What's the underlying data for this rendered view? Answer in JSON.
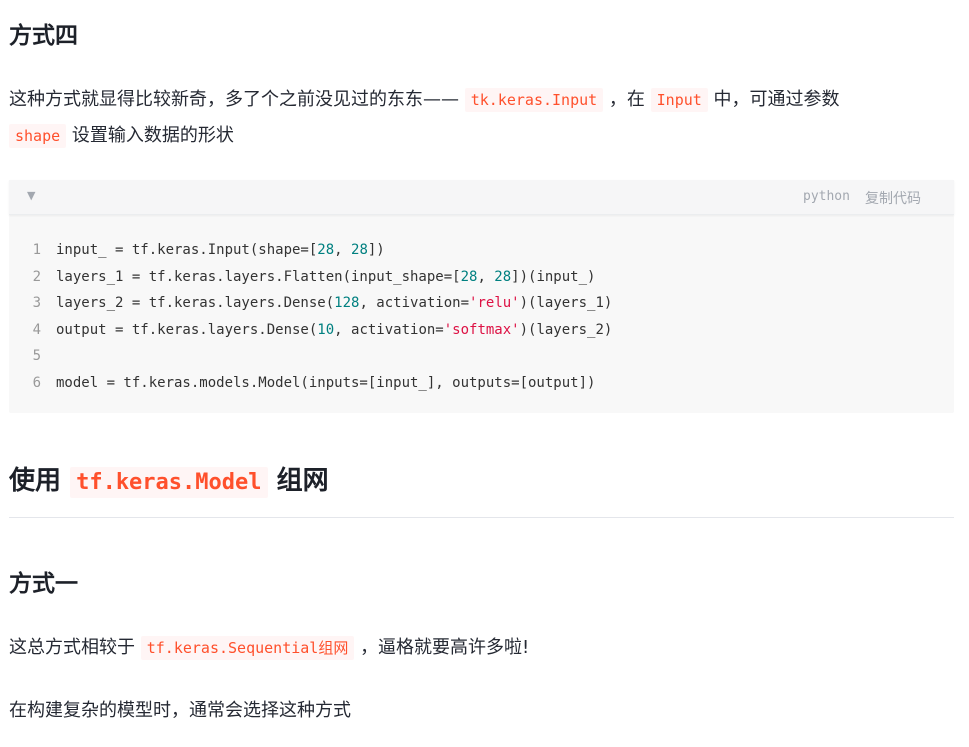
{
  "section4": {
    "heading": "方式四",
    "para1_part1": "这种方式就显得比较新奇，多了个之前没见过的东东——",
    "para1_code1": "tk.keras.Input",
    "para1_part2": "，在",
    "para1_code2": "Input",
    "para1_part3": "中，可通过参数",
    "para1_code3": "shape",
    "para1_part4": "设置输入数据的形状"
  },
  "codeblock": {
    "toggle_icon": "▼",
    "language": "python",
    "copy_label": "复制代码",
    "lines": [
      {
        "no": "1",
        "parts": [
          "input_ = tf.keras.Input(shape=[",
          "28",
          ", ",
          "28",
          "])"
        ]
      },
      {
        "no": "2",
        "parts": [
          "layers_1 = tf.keras.layers.Flatten(input_shape=[",
          "28",
          ", ",
          "28",
          "])(input_)"
        ]
      },
      {
        "no": "3",
        "parts": [
          "layers_2 = tf.keras.layers.Dense(",
          "128",
          ", activation=",
          "'relu'",
          ")(layers_1)"
        ]
      },
      {
        "no": "4",
        "parts": [
          "output = tf.keras.layers.Dense(",
          "10",
          ", activation=",
          "'softmax'",
          ")(layers_2)"
        ]
      },
      {
        "no": "5",
        "parts": [
          ""
        ]
      },
      {
        "no": "6",
        "parts": [
          "model = tf.keras.models.Model(inputs=[input_], outputs=[output])"
        ]
      }
    ]
  },
  "section_model": {
    "heading_prefix": "使用",
    "heading_code": "tf.keras.Model",
    "heading_suffix": "组网"
  },
  "section1": {
    "heading": "方式一",
    "para1_part1": "这总方式相较于",
    "para1_code": "tf.keras.Sequential组网",
    "para1_part2": "，逼格就要高许多啦!",
    "para2": "在构建复杂的模型时，通常会选择这种方式"
  },
  "colors": {
    "inline_code_text": "#ff502c",
    "inline_code_bg": "#fff5f5",
    "number": "#008080",
    "string": "#dd1144"
  }
}
